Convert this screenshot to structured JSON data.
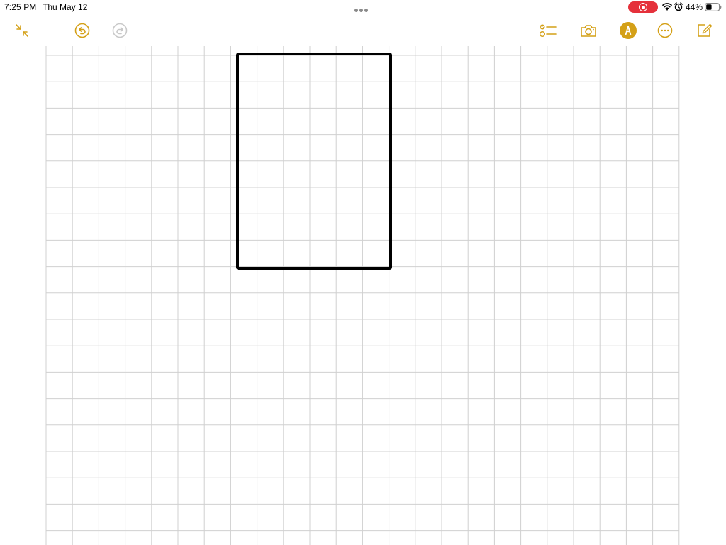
{
  "status_bar": {
    "time": "7:25 PM",
    "date": "Thu May 12",
    "battery_percent": "44%",
    "battery_level": 0.44,
    "record_color": "#e5313b",
    "icons": [
      "wifi-icon",
      "alarm-icon",
      "battery-icon",
      "screen-record-icon",
      "multitasking-dots-icon"
    ]
  },
  "toolbar": {
    "accent_color": "#d4a017",
    "disabled_color": "#c8c8c8",
    "left_icons": [
      "collapse-arrows-icon",
      "undo-icon",
      "redo-icon"
    ],
    "right_icons": [
      "checklist-icon",
      "camera-icon",
      "markup-pen-icon",
      "more-ellipsis-icon",
      "compose-icon"
    ],
    "redo_enabled": false
  },
  "canvas": {
    "background": "grid",
    "grid_color": "#d0d0d0",
    "ink_color": "#000000",
    "drawing": {
      "shape": "rectangle",
      "width_cells": 6,
      "height_cells": 8
    }
  }
}
